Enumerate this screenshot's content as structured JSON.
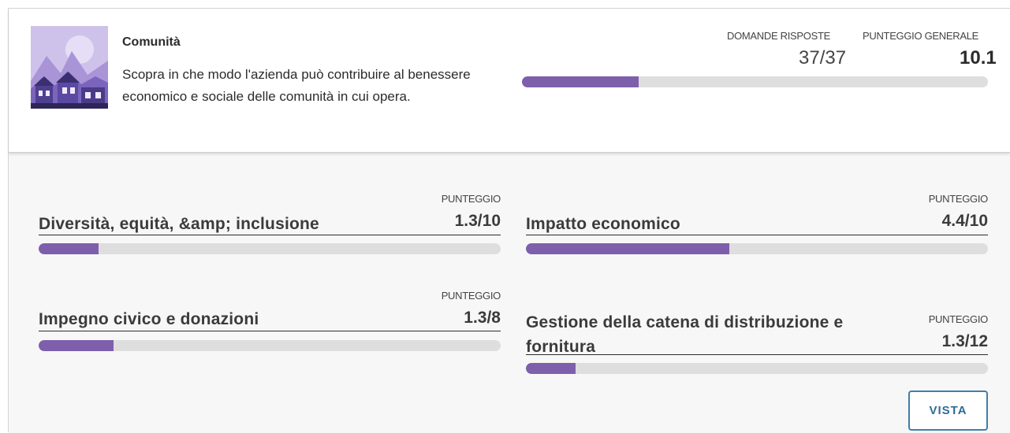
{
  "header": {
    "title": "Comunità",
    "description": "Scopra in che modo l'azienda può contribuire al benessere economico e sociale delle comunità in cui opera.",
    "answered_label": "DOMANDE RISPOSTE",
    "answered_value": "37/37",
    "overall_label": "PUNTEGGIO GENERALE",
    "overall_value": "10.1",
    "overall_progress": 0.25,
    "image": "community-illustration"
  },
  "categories": [
    {
      "name": "Diversità, equità, &amp; inclusione",
      "score_label": "PUNTEGGIO",
      "score": "1.3/10",
      "progress": 0.13
    },
    {
      "name": "Impatto economico",
      "score_label": "PUNTEGGIO",
      "score": "4.4/10",
      "progress": 0.44
    },
    {
      "name": "Impegno civico e donazioni",
      "score_label": "PUNTEGGIO",
      "score": "1.3/8",
      "progress": 0.1625
    },
    {
      "name": "Gestione della catena di distribuzione e fornitura",
      "score_label": "PUNTEGGIO",
      "score": "1.3/12",
      "progress": 0.108
    }
  ],
  "actions": {
    "view_label": "VISTA"
  },
  "colors": {
    "accent": "#7d5fac",
    "track": "#dedede",
    "button": "#3f7fa8"
  }
}
